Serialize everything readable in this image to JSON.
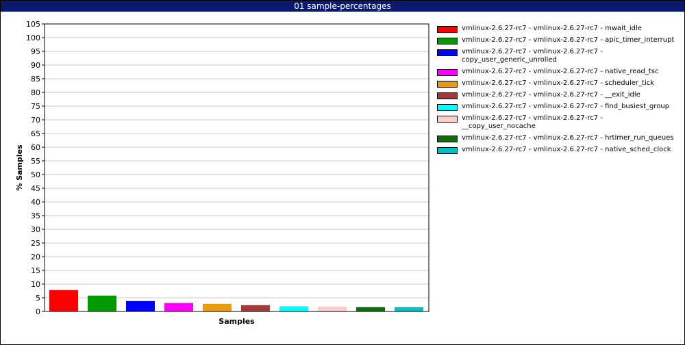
{
  "window": {
    "title": "01 sample-percentages"
  },
  "chart_data": {
    "type": "bar",
    "title": "",
    "xlabel": "Samples",
    "ylabel": "% Samples",
    "ylim": [
      0,
      105
    ],
    "y_ticks": [
      0,
      5,
      10,
      15,
      20,
      25,
      30,
      35,
      40,
      45,
      50,
      55,
      60,
      65,
      70,
      75,
      80,
      85,
      90,
      95,
      100,
      105
    ],
    "grid": true,
    "legend_position": "right",
    "series": [
      {
        "name": "vmlinux-2.6.27-rc7 - vmlinux-2.6.27-rc7 - mwait_idle",
        "value": 7.8,
        "color": "#ff0000"
      },
      {
        "name": "vmlinux-2.6.27-rc7 - vmlinux-2.6.27-rc7 - apic_timer_interrupt",
        "value": 5.8,
        "color": "#009900"
      },
      {
        "name": "vmlinux-2.6.27-rc7 - vmlinux-2.6.27-rc7 -\ncopy_user_generic_unrolled",
        "value": 3.8,
        "color": "#0000ff"
      },
      {
        "name": "vmlinux-2.6.27-rc7 - vmlinux-2.6.27-rc7 - native_read_tsc",
        "value": 3.1,
        "color": "#ff00ff"
      },
      {
        "name": "vmlinux-2.6.27-rc7 - vmlinux-2.6.27-rc7 - scheduler_tick",
        "value": 2.8,
        "color": "#e89a10"
      },
      {
        "name": "vmlinux-2.6.27-rc7 - vmlinux-2.6.27-rc7 - __exit_idle",
        "value": 2.3,
        "color": "#a33a3a"
      },
      {
        "name": "vmlinux-2.6.27-rc7 - vmlinux-2.6.27-rc7 - find_busiest_group",
        "value": 1.9,
        "color": "#00ffff"
      },
      {
        "name": "vmlinux-2.6.27-rc7 - vmlinux-2.6.27-rc7 -\n__copy_user_nocache",
        "value": 1.8,
        "color": "#ffcccc"
      },
      {
        "name": "vmlinux-2.6.27-rc7 - vmlinux-2.6.27-rc7 - hrtimer_run_queues",
        "value": 1.6,
        "color": "#0a6e0a"
      },
      {
        "name": "vmlinux-2.6.27-rc7 - vmlinux-2.6.27-rc7 - native_sched_clock",
        "value": 1.6,
        "color": "#00bfbf"
      }
    ]
  }
}
